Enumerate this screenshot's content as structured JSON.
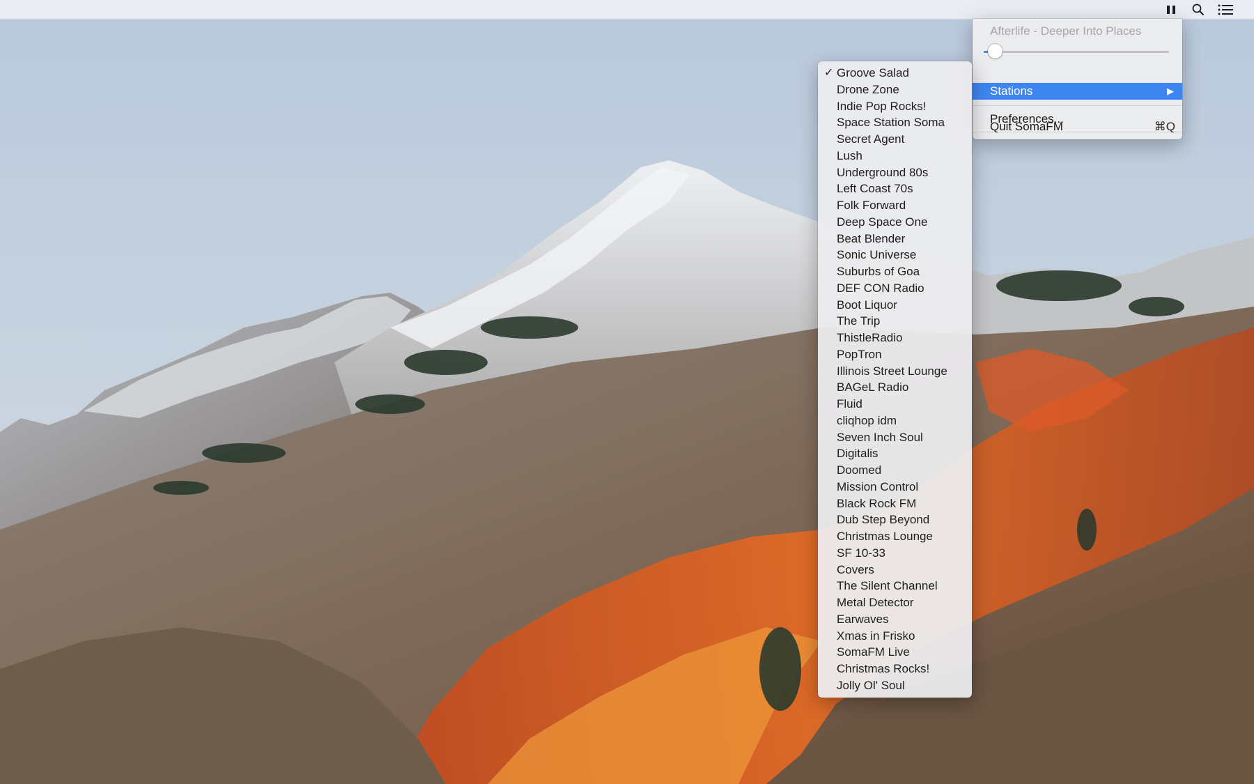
{
  "menubar": {
    "icons": [
      "pause-icon",
      "search-icon",
      "list-icon"
    ]
  },
  "app_menu": {
    "now_playing": "Afterlife - Deeper Into Places",
    "volume": 0.06,
    "stations_label": "Stations",
    "stations_arrow": "▶",
    "preferences_label": "Preferences...",
    "quit_label": "Quit SomaFM",
    "quit_shortcut": "⌘Q"
  },
  "stations": {
    "selected": "Groove Salad",
    "check_mark": "✓",
    "items": [
      "Groove Salad",
      "Drone Zone",
      "Indie Pop Rocks!",
      "Space Station Soma",
      "Secret Agent",
      "Lush",
      "Underground 80s",
      "Left Coast 70s",
      "Folk Forward",
      "Deep Space One",
      "Beat Blender",
      "Sonic Universe",
      "Suburbs of Goa",
      "DEF CON Radio",
      "Boot Liquor",
      "The Trip",
      "ThistleRadio",
      "PopTron",
      "Illinois Street Lounge",
      "BAGeL Radio",
      "Fluid",
      "cliqhop idm",
      "Seven Inch Soul",
      "Digitalis",
      "Doomed",
      "Mission Control",
      "Black Rock FM",
      "Dub Step Beyond",
      "Christmas Lounge",
      "SF 10-33",
      "Covers",
      "The Silent Channel",
      "Metal Detector",
      "Earwaves",
      "Xmas in Frisko",
      "SomaFM Live",
      "Christmas Rocks!",
      "Jolly Ol' Soul"
    ]
  },
  "colors": {
    "highlight": "#3d86f1",
    "disabled_text": "#a6a6a8"
  }
}
